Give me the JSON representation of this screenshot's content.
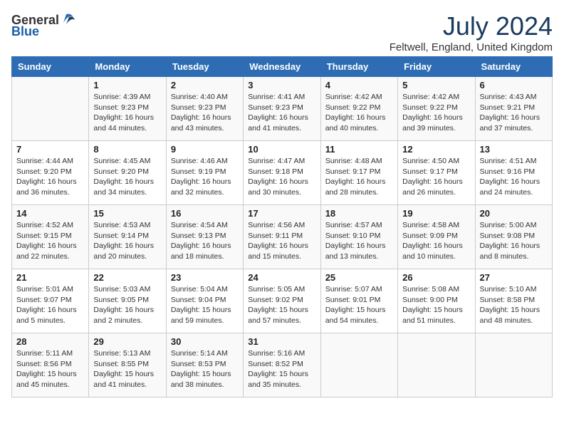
{
  "header": {
    "logo_general": "General",
    "logo_blue": "Blue",
    "title": "July 2024",
    "location": "Feltwell, England, United Kingdom"
  },
  "days_of_week": [
    "Sunday",
    "Monday",
    "Tuesday",
    "Wednesday",
    "Thursday",
    "Friday",
    "Saturday"
  ],
  "weeks": [
    [
      {
        "day": "",
        "sunrise": "",
        "sunset": "",
        "daylight": ""
      },
      {
        "day": "1",
        "sunrise": "Sunrise: 4:39 AM",
        "sunset": "Sunset: 9:23 PM",
        "daylight": "Daylight: 16 hours and 44 minutes."
      },
      {
        "day": "2",
        "sunrise": "Sunrise: 4:40 AM",
        "sunset": "Sunset: 9:23 PM",
        "daylight": "Daylight: 16 hours and 43 minutes."
      },
      {
        "day": "3",
        "sunrise": "Sunrise: 4:41 AM",
        "sunset": "Sunset: 9:23 PM",
        "daylight": "Daylight: 16 hours and 41 minutes."
      },
      {
        "day": "4",
        "sunrise": "Sunrise: 4:42 AM",
        "sunset": "Sunset: 9:22 PM",
        "daylight": "Daylight: 16 hours and 40 minutes."
      },
      {
        "day": "5",
        "sunrise": "Sunrise: 4:42 AM",
        "sunset": "Sunset: 9:22 PM",
        "daylight": "Daylight: 16 hours and 39 minutes."
      },
      {
        "day": "6",
        "sunrise": "Sunrise: 4:43 AM",
        "sunset": "Sunset: 9:21 PM",
        "daylight": "Daylight: 16 hours and 37 minutes."
      }
    ],
    [
      {
        "day": "7",
        "sunrise": "Sunrise: 4:44 AM",
        "sunset": "Sunset: 9:20 PM",
        "daylight": "Daylight: 16 hours and 36 minutes."
      },
      {
        "day": "8",
        "sunrise": "Sunrise: 4:45 AM",
        "sunset": "Sunset: 9:20 PM",
        "daylight": "Daylight: 16 hours and 34 minutes."
      },
      {
        "day": "9",
        "sunrise": "Sunrise: 4:46 AM",
        "sunset": "Sunset: 9:19 PM",
        "daylight": "Daylight: 16 hours and 32 minutes."
      },
      {
        "day": "10",
        "sunrise": "Sunrise: 4:47 AM",
        "sunset": "Sunset: 9:18 PM",
        "daylight": "Daylight: 16 hours and 30 minutes."
      },
      {
        "day": "11",
        "sunrise": "Sunrise: 4:48 AM",
        "sunset": "Sunset: 9:17 PM",
        "daylight": "Daylight: 16 hours and 28 minutes."
      },
      {
        "day": "12",
        "sunrise": "Sunrise: 4:50 AM",
        "sunset": "Sunset: 9:17 PM",
        "daylight": "Daylight: 16 hours and 26 minutes."
      },
      {
        "day": "13",
        "sunrise": "Sunrise: 4:51 AM",
        "sunset": "Sunset: 9:16 PM",
        "daylight": "Daylight: 16 hours and 24 minutes."
      }
    ],
    [
      {
        "day": "14",
        "sunrise": "Sunrise: 4:52 AM",
        "sunset": "Sunset: 9:15 PM",
        "daylight": "Daylight: 16 hours and 22 minutes."
      },
      {
        "day": "15",
        "sunrise": "Sunrise: 4:53 AM",
        "sunset": "Sunset: 9:14 PM",
        "daylight": "Daylight: 16 hours and 20 minutes."
      },
      {
        "day": "16",
        "sunrise": "Sunrise: 4:54 AM",
        "sunset": "Sunset: 9:13 PM",
        "daylight": "Daylight: 16 hours and 18 minutes."
      },
      {
        "day": "17",
        "sunrise": "Sunrise: 4:56 AM",
        "sunset": "Sunset: 9:11 PM",
        "daylight": "Daylight: 16 hours and 15 minutes."
      },
      {
        "day": "18",
        "sunrise": "Sunrise: 4:57 AM",
        "sunset": "Sunset: 9:10 PM",
        "daylight": "Daylight: 16 hours and 13 minutes."
      },
      {
        "day": "19",
        "sunrise": "Sunrise: 4:58 AM",
        "sunset": "Sunset: 9:09 PM",
        "daylight": "Daylight: 16 hours and 10 minutes."
      },
      {
        "day": "20",
        "sunrise": "Sunrise: 5:00 AM",
        "sunset": "Sunset: 9:08 PM",
        "daylight": "Daylight: 16 hours and 8 minutes."
      }
    ],
    [
      {
        "day": "21",
        "sunrise": "Sunrise: 5:01 AM",
        "sunset": "Sunset: 9:07 PM",
        "daylight": "Daylight: 16 hours and 5 minutes."
      },
      {
        "day": "22",
        "sunrise": "Sunrise: 5:03 AM",
        "sunset": "Sunset: 9:05 PM",
        "daylight": "Daylight: 16 hours and 2 minutes."
      },
      {
        "day": "23",
        "sunrise": "Sunrise: 5:04 AM",
        "sunset": "Sunset: 9:04 PM",
        "daylight": "Daylight: 15 hours and 59 minutes."
      },
      {
        "day": "24",
        "sunrise": "Sunrise: 5:05 AM",
        "sunset": "Sunset: 9:02 PM",
        "daylight": "Daylight: 15 hours and 57 minutes."
      },
      {
        "day": "25",
        "sunrise": "Sunrise: 5:07 AM",
        "sunset": "Sunset: 9:01 PM",
        "daylight": "Daylight: 15 hours and 54 minutes."
      },
      {
        "day": "26",
        "sunrise": "Sunrise: 5:08 AM",
        "sunset": "Sunset: 9:00 PM",
        "daylight": "Daylight: 15 hours and 51 minutes."
      },
      {
        "day": "27",
        "sunrise": "Sunrise: 5:10 AM",
        "sunset": "Sunset: 8:58 PM",
        "daylight": "Daylight: 15 hours and 48 minutes."
      }
    ],
    [
      {
        "day": "28",
        "sunrise": "Sunrise: 5:11 AM",
        "sunset": "Sunset: 8:56 PM",
        "daylight": "Daylight: 15 hours and 45 minutes."
      },
      {
        "day": "29",
        "sunrise": "Sunrise: 5:13 AM",
        "sunset": "Sunset: 8:55 PM",
        "daylight": "Daylight: 15 hours and 41 minutes."
      },
      {
        "day": "30",
        "sunrise": "Sunrise: 5:14 AM",
        "sunset": "Sunset: 8:53 PM",
        "daylight": "Daylight: 15 hours and 38 minutes."
      },
      {
        "day": "31",
        "sunrise": "Sunrise: 5:16 AM",
        "sunset": "Sunset: 8:52 PM",
        "daylight": "Daylight: 15 hours and 35 minutes."
      },
      {
        "day": "",
        "sunrise": "",
        "sunset": "",
        "daylight": ""
      },
      {
        "day": "",
        "sunrise": "",
        "sunset": "",
        "daylight": ""
      },
      {
        "day": "",
        "sunrise": "",
        "sunset": "",
        "daylight": ""
      }
    ]
  ]
}
